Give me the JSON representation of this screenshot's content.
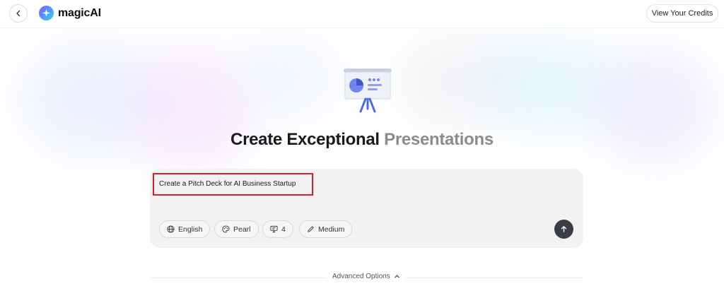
{
  "header": {
    "brand": "magicAI",
    "credits_label": "View Your Credits"
  },
  "hero": {
    "title_main": "Create Exceptional",
    "title_muted": "Presentations"
  },
  "prompt": {
    "value": "Create a Pitch Deck for AI Business Startup"
  },
  "options": {
    "language": "English",
    "theme": "Pearl",
    "slides": "4",
    "length": "Medium"
  },
  "advanced": {
    "label": "Advanced Options"
  },
  "icons": [
    "back-arrow-icon",
    "sparkle-logo-icon",
    "presentation-board-icon",
    "globe-icon",
    "palette-icon",
    "slides-icon",
    "pencil-icon",
    "arrow-up-icon",
    "chevron-up-icon"
  ],
  "colors": {
    "highlight_border": "#d4202b",
    "send_button": "#3a3d45",
    "card_bg": "#f2f2f2",
    "title_muted": "#8b8b90"
  }
}
